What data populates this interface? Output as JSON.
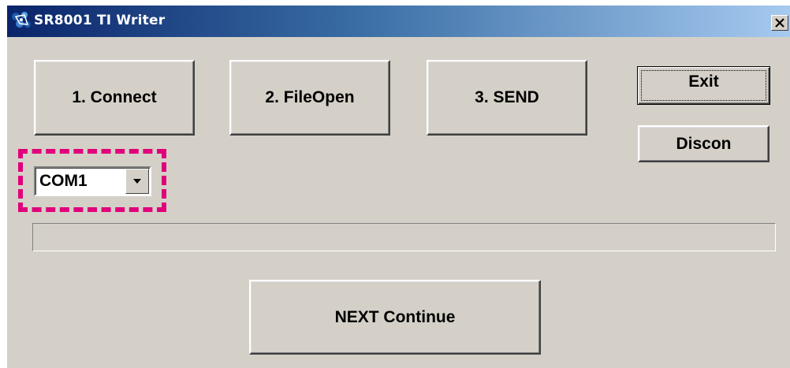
{
  "window": {
    "title": "SR8001 TI Writer",
    "close_label": "close"
  },
  "buttons": {
    "connect": "1. Connect",
    "file_open": "2. FileOpen",
    "send": "3. SEND",
    "exit": "Exit",
    "discon": "Discon",
    "next_continue": "NEXT Continue"
  },
  "port_select": {
    "selected": "COM1"
  },
  "progress": {
    "value": 0
  },
  "icons": {
    "app": "app-icon",
    "close": "close-icon",
    "dropdown": "chevron-down-icon"
  },
  "colors": {
    "title_start": "#0a246a",
    "title_end": "#a6caf0",
    "face": "#d4d0c8",
    "highlight": "#e0007a"
  }
}
